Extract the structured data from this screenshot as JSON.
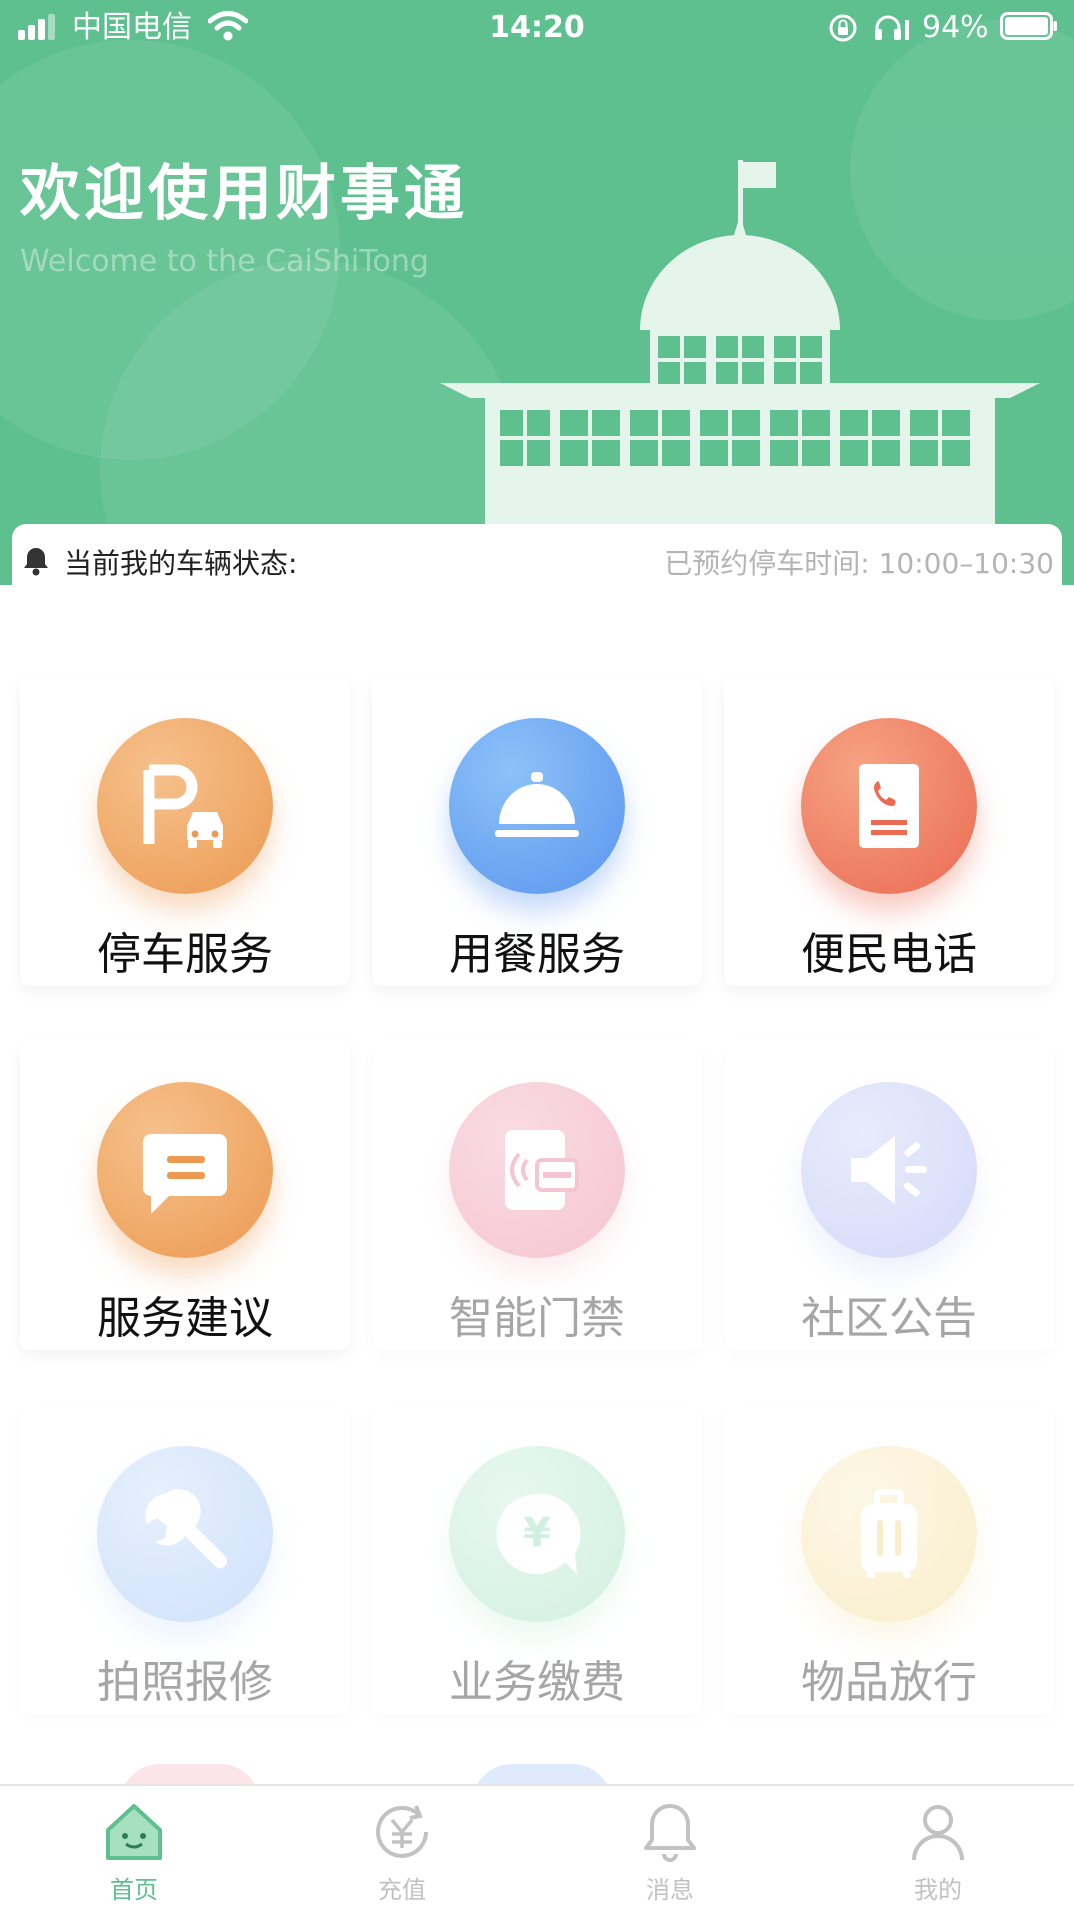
{
  "status_bar": {
    "carrier": "中国电信",
    "time": "14:20",
    "battery": "94%",
    "icons": [
      "signal-icon",
      "wifi-icon",
      "orientation-lock-icon",
      "headphone-icon",
      "battery-icon"
    ]
  },
  "header": {
    "title": "欢迎使用财事通",
    "subtitle": "Welcome to the CaiShiTong"
  },
  "vehicle_status": {
    "label": "当前我的车辆状态:",
    "reservation": "已预约停车时间: 10:00–10:30"
  },
  "services": [
    {
      "label": "停车服务",
      "icon": "parking-icon",
      "color": "#efa35c"
    },
    {
      "label": "用餐服务",
      "icon": "dining-cloche-icon",
      "color": "#5d9ff0"
    },
    {
      "label": "便民电话",
      "icon": "phone-book-icon",
      "color": "#ee7a5e"
    },
    {
      "label": "服务建议",
      "icon": "chat-icon",
      "color": "#efa35c"
    },
    {
      "label": "智能门禁",
      "icon": "access-card-icon",
      "color": "#f7cfd9"
    },
    {
      "label": "社区公告",
      "icon": "announcement-icon",
      "color": "#dde1fa"
    },
    {
      "label": "拍照报修",
      "icon": "wrench-icon",
      "color": "#d8e8fb"
    },
    {
      "label": "业务缴费",
      "icon": "payment-icon",
      "color": "#d9f2e4"
    },
    {
      "label": "物品放行",
      "icon": "luggage-icon",
      "color": "#fbf2d8"
    }
  ],
  "tabbar": [
    {
      "label": "首页",
      "icon": "home-icon",
      "active": true
    },
    {
      "label": "充值",
      "icon": "recharge-icon",
      "active": false
    },
    {
      "label": "消息",
      "icon": "bell-icon",
      "active": false
    },
    {
      "label": "我的",
      "icon": "profile-icon",
      "active": false
    }
  ],
  "colors": {
    "brand_green": "#5ec08f",
    "inactive_text": "#a6a6a6"
  }
}
